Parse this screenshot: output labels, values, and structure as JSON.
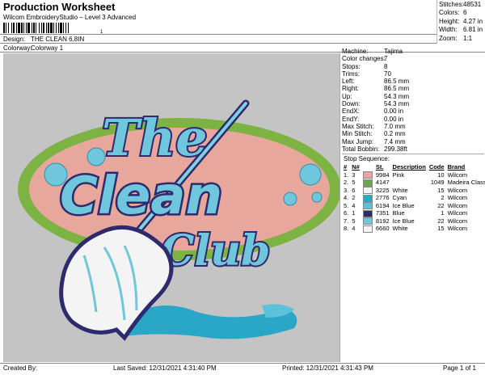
{
  "header": {
    "title": "Production Worksheet",
    "subtitle": "Wilcom EmbroideryStudio – Level 3 Advanced",
    "barcode_number": "1"
  },
  "meta": {
    "design_label": "Design:",
    "design_value": "THE CLEAN 6,8IN",
    "colorway_label": "Colorway:",
    "colorway_value": "Colorway 1"
  },
  "stats": [
    {
      "label": "Stitches:",
      "value": "48531"
    },
    {
      "label": "Colors:",
      "value": "6"
    },
    {
      "label": "Height:",
      "value": "4.27 in"
    },
    {
      "label": "Width:",
      "value": "6.81 in"
    },
    {
      "label": "Zoom:",
      "value": "1:1"
    }
  ],
  "info": [
    {
      "label": "Machine:",
      "value": "Tajima"
    },
    {
      "label": "Color changes:",
      "value": "7"
    },
    {
      "label": "Stops:",
      "value": "8"
    },
    {
      "label": "Trims:",
      "value": "70"
    },
    {
      "label": "Left:",
      "value": "86.5 mm"
    },
    {
      "label": "Right:",
      "value": "86.5 mm"
    },
    {
      "label": "Up:",
      "value": "54.3 mm"
    },
    {
      "label": "Down:",
      "value": "54.3 mm"
    },
    {
      "label": "EndX:",
      "value": "0.00 in"
    },
    {
      "label": "EndY:",
      "value": "0.00 in"
    },
    {
      "label": "Max Stitch:",
      "value": "7.0 mm"
    },
    {
      "label": "Min Stitch:",
      "value": "0.2 mm"
    },
    {
      "label": "Max Jump:",
      "value": "7.4 mm"
    },
    {
      "label": "Total Bobbin:",
      "value": "299.38ft"
    }
  ],
  "sequence": {
    "title": "Stop Sequence:",
    "headers": [
      "#",
      "N#",
      "",
      "St.",
      "Description",
      "Code",
      "Brand"
    ],
    "rows": [
      {
        "n": "1.",
        "needle": "3",
        "color": "#e8a4a0",
        "st": "9984",
        "desc": "Pink",
        "code": "10",
        "brand": "Wilcom"
      },
      {
        "n": "2.",
        "needle": "5",
        "color": "#6aa84f",
        "st": "4147",
        "desc": "",
        "code": "1049",
        "brand": "Madeira Classic 40"
      },
      {
        "n": "3.",
        "needle": "6",
        "color": "#f4f4f4",
        "st": "3225",
        "desc": "White",
        "code": "15",
        "brand": "Wilcom"
      },
      {
        "n": "4.",
        "needle": "2",
        "color": "#29a8c9",
        "st": "2776",
        "desc": "Cyan",
        "code": "2",
        "brand": "Wilcom"
      },
      {
        "n": "5.",
        "needle": "4",
        "color": "#5cc1d9",
        "st": "6194",
        "desc": "Ice Blue",
        "code": "22",
        "brand": "Wilcom"
      },
      {
        "n": "6.",
        "needle": "1",
        "color": "#2d2a6e",
        "st": "7351",
        "desc": "Blue",
        "code": "1",
        "brand": "Wilcom"
      },
      {
        "n": "7.",
        "needle": "5",
        "color": "#6fc6dd",
        "st": "8192",
        "desc": "Ice Blue",
        "code": "22",
        "brand": "Wilcom"
      },
      {
        "n": "8.",
        "needle": "4",
        "color": "#f4f4f4",
        "st": "6660",
        "desc": "White",
        "code": "15",
        "brand": "Wilcom"
      }
    ]
  },
  "design_art": {
    "line1": "The",
    "line2": "Clean",
    "line3": "Club"
  },
  "footer": {
    "created": "Created By:",
    "saved": "Last Saved: 12/31/2021 4:31:40 PM",
    "printed": "Printed: 12/31/2021 4:31:43 PM",
    "page": "Page 1 of 1"
  }
}
